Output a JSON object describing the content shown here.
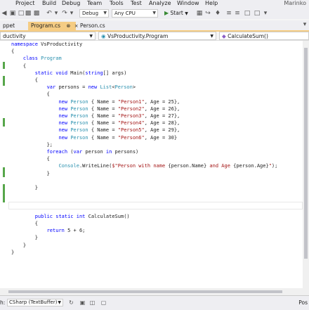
{
  "menu": {
    "items": [
      "Project",
      "Build",
      "Debug",
      "Team",
      "Tools",
      "Test",
      "Analyze",
      "Window",
      "Help"
    ],
    "user": "Marinko"
  },
  "toolbar": {
    "config": "Debug",
    "platform": "Any CPU",
    "start_label": "Start"
  },
  "tabs": [
    {
      "label": "ppet",
      "active": false
    },
    {
      "label": "Program.cs",
      "active": true
    },
    {
      "label": "Person.cs",
      "active": false
    }
  ],
  "navbar": {
    "project": "ductivity",
    "class": "VsProductivity.Program",
    "member": "CalculateSum()"
  },
  "code_lines": [
    [
      [
        "kw",
        "namespace"
      ],
      [
        "pl",
        " VsProductivity"
      ]
    ],
    [
      [
        "pl",
        "{"
      ]
    ],
    [
      [
        "pl",
        "    "
      ],
      [
        "kw",
        "class"
      ],
      [
        "pl",
        " "
      ],
      [
        "ty",
        "Program"
      ]
    ],
    [
      [
        "pl",
        "    {"
      ]
    ],
    [
      [
        "pl",
        "        "
      ],
      [
        "kw",
        "static"
      ],
      [
        "pl",
        " "
      ],
      [
        "kw",
        "void"
      ],
      [
        "pl",
        " Main("
      ],
      [
        "kw",
        "string"
      ],
      [
        "pl",
        "[] args)"
      ]
    ],
    [
      [
        "pl",
        "        {"
      ]
    ],
    [
      [
        "pl",
        "            "
      ],
      [
        "kw",
        "var"
      ],
      [
        "pl",
        " persons = "
      ],
      [
        "kw",
        "new"
      ],
      [
        "pl",
        " "
      ],
      [
        "ty",
        "List"
      ],
      [
        "pl",
        "<"
      ],
      [
        "ty",
        "Person"
      ],
      [
        "pl",
        ">"
      ]
    ],
    [
      [
        "pl",
        "            {"
      ]
    ],
    [
      [
        "pl",
        "                "
      ],
      [
        "kw",
        "new"
      ],
      [
        "pl",
        " "
      ],
      [
        "ty",
        "Person"
      ],
      [
        "pl",
        " { Name = "
      ],
      [
        "st",
        "\"Person1\""
      ],
      [
        "pl",
        ", Age = 25},"
      ]
    ],
    [
      [
        "pl",
        "                "
      ],
      [
        "kw",
        "new"
      ],
      [
        "pl",
        " "
      ],
      [
        "ty",
        "Person"
      ],
      [
        "pl",
        " { Name = "
      ],
      [
        "st",
        "\"Person2\""
      ],
      [
        "pl",
        ", Age = 26},"
      ]
    ],
    [
      [
        "pl",
        "                "
      ],
      [
        "kw",
        "new"
      ],
      [
        "pl",
        " "
      ],
      [
        "ty",
        "Person"
      ],
      [
        "pl",
        " { Name = "
      ],
      [
        "st",
        "\"Person3\""
      ],
      [
        "pl",
        ", Age = 27},"
      ]
    ],
    [
      [
        "pl",
        "                "
      ],
      [
        "kw",
        "new"
      ],
      [
        "pl",
        " "
      ],
      [
        "ty",
        "Person"
      ],
      [
        "pl",
        " { Name = "
      ],
      [
        "st",
        "\"Person4\""
      ],
      [
        "pl",
        ", Age = 28},"
      ]
    ],
    [
      [
        "pl",
        "                "
      ],
      [
        "kw",
        "new"
      ],
      [
        "pl",
        " "
      ],
      [
        "ty",
        "Person"
      ],
      [
        "pl",
        " { Name = "
      ],
      [
        "st",
        "\"Person5\""
      ],
      [
        "pl",
        ", Age = 29},"
      ]
    ],
    [
      [
        "pl",
        "                "
      ],
      [
        "kw",
        "new"
      ],
      [
        "pl",
        " "
      ],
      [
        "ty",
        "Person"
      ],
      [
        "pl",
        " { Name = "
      ],
      [
        "st",
        "\"Person6\""
      ],
      [
        "pl",
        ", Age = 30}"
      ]
    ],
    [
      [
        "pl",
        "            };"
      ]
    ],
    [
      [
        "pl",
        "            "
      ],
      [
        "kw",
        "foreach"
      ],
      [
        "pl",
        " ("
      ],
      [
        "kw",
        "var"
      ],
      [
        "pl",
        " person "
      ],
      [
        "kw",
        "in"
      ],
      [
        "pl",
        " persons)"
      ]
    ],
    [
      [
        "pl",
        "            {"
      ]
    ],
    [
      [
        "pl",
        "                "
      ],
      [
        "ty",
        "Console"
      ],
      [
        "pl",
        ".WriteLine("
      ],
      [
        "st",
        "$\"Person with name "
      ],
      [
        "pl",
        "{person.Name}"
      ],
      [
        "st",
        " and Age "
      ],
      [
        "pl",
        "{person.Age}"
      ],
      [
        "st",
        "\""
      ],
      [
        "pl",
        ");"
      ]
    ],
    [
      [
        "pl",
        "            }"
      ]
    ],
    [
      [
        "pl",
        ""
      ]
    ],
    [
      [
        "pl",
        "        }"
      ]
    ],
    [
      [
        "pl",
        ""
      ]
    ],
    [
      [
        "pl",
        ""
      ]
    ],
    [
      [
        "pl",
        ""
      ]
    ],
    [
      [
        "pl",
        "        "
      ],
      [
        "kw",
        "public"
      ],
      [
        "pl",
        " "
      ],
      [
        "kw",
        "static"
      ],
      [
        "pl",
        " "
      ],
      [
        "kw",
        "int"
      ],
      [
        "pl",
        " CalculateSum()"
      ]
    ],
    [
      [
        "pl",
        "        {"
      ]
    ],
    [
      [
        "pl",
        "            "
      ],
      [
        "kw",
        "return"
      ],
      [
        "pl",
        " 5 + 6;"
      ]
    ],
    [
      [
        "pl",
        "        }"
      ]
    ],
    [
      [
        "pl",
        "    }"
      ]
    ],
    [
      [
        "pl",
        "}"
      ]
    ]
  ],
  "bottombar": {
    "label": "h:",
    "language": "CSharp (TextBuffer)",
    "position": "Pos"
  }
}
